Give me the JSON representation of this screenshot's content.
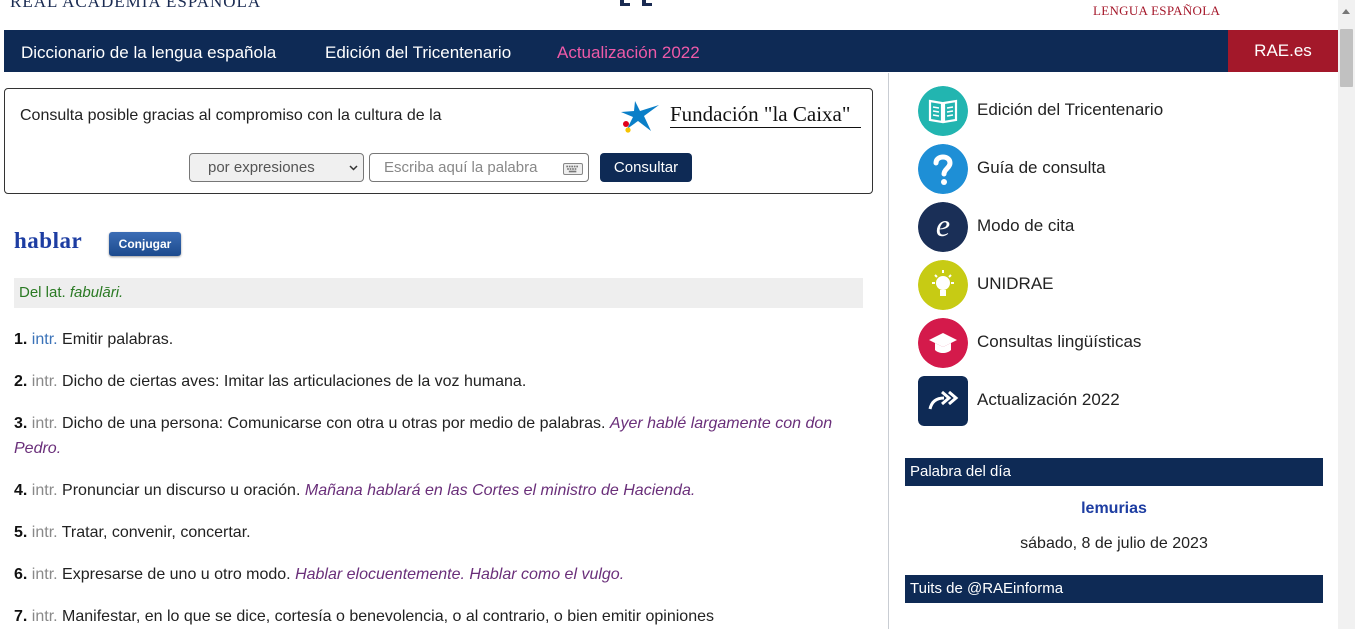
{
  "header": {
    "left_org": "REAL ACADEMIA ESPAÑOLA",
    "right_org": "LENGUA ESPAÑOLA"
  },
  "nav": {
    "items": [
      "Diccionario de la lengua española",
      "Edición del Tricentenario",
      "Actualización 2022"
    ],
    "rae_button": "RAE.es",
    "accent_color": "#ee5aa8",
    "bar_color": "#0e2a55",
    "rae_color": "#a3182a"
  },
  "sponsor": {
    "text": "Consulta posible gracias al compromiso con la cultura de la",
    "logo_text": "Fundación \"la Caixa\""
  },
  "search": {
    "mode": "por expresiones",
    "placeholder": "Escriba aquí la palabra",
    "button": "Consultar"
  },
  "entry": {
    "headword": "hablar",
    "conjugate_button": "Conjugar",
    "etym_prefix": "Del lat.",
    "etym_word": "fabulāri.",
    "definitions": [
      {
        "num": "1.",
        "abbr": "intr.",
        "text": "Emitir palabras.",
        "example": ""
      },
      {
        "num": "2.",
        "abbr": "intr.",
        "text": "Dicho de ciertas aves: Imitar las articulaciones de la voz humana.",
        "example": ""
      },
      {
        "num": "3.",
        "abbr": "intr.",
        "text": "Dicho de una persona: Comunicarse con otra u otras por medio de palabras.",
        "example": "Ayer hablé largamente con don Pedro."
      },
      {
        "num": "4.",
        "abbr": "intr.",
        "text": "Pronunciar un discurso u oración.",
        "example": "Mañana hablará en las Cortes el ministro de Hacienda."
      },
      {
        "num": "5.",
        "abbr": "intr.",
        "text": "Tratar, convenir, concertar.",
        "example": ""
      },
      {
        "num": "6.",
        "abbr": "intr.",
        "text": "Expresarse de uno u otro modo.",
        "example": "Hablar elocuentemente. Hablar como el vulgo."
      },
      {
        "num": "7.",
        "abbr": "intr.",
        "text": "Manifestar, en lo que se dice, cortesía o benevolencia, o al contrario, o bien emitir opiniones",
        "example": ""
      }
    ]
  },
  "sidebar": {
    "items": [
      {
        "label": "Edición del Tricentenario",
        "icon": "book-icon",
        "color": "#22b5b0"
      },
      {
        "label": "Guía de consulta",
        "icon": "question-icon",
        "color": "#1e8fd6"
      },
      {
        "label": "Modo de cita",
        "icon": "e-letter-icon",
        "color": "#1a2f57"
      },
      {
        "label": "UNIDRAE",
        "icon": "lightbulb-icon",
        "color": "#c7cb14"
      },
      {
        "label": "Consultas lingüísticas",
        "icon": "graduation-cap-icon",
        "color": "#d41a4b"
      },
      {
        "label": "Actualización 2022",
        "icon": "double-arrow-icon",
        "color": "#0e2a55"
      }
    ],
    "word_of_day_title": "Palabra del día",
    "word_of_day": "lemurias",
    "word_date": "sábado, 8 de julio de 2023",
    "tweets_title": "Tuits de @RAEinforma"
  }
}
